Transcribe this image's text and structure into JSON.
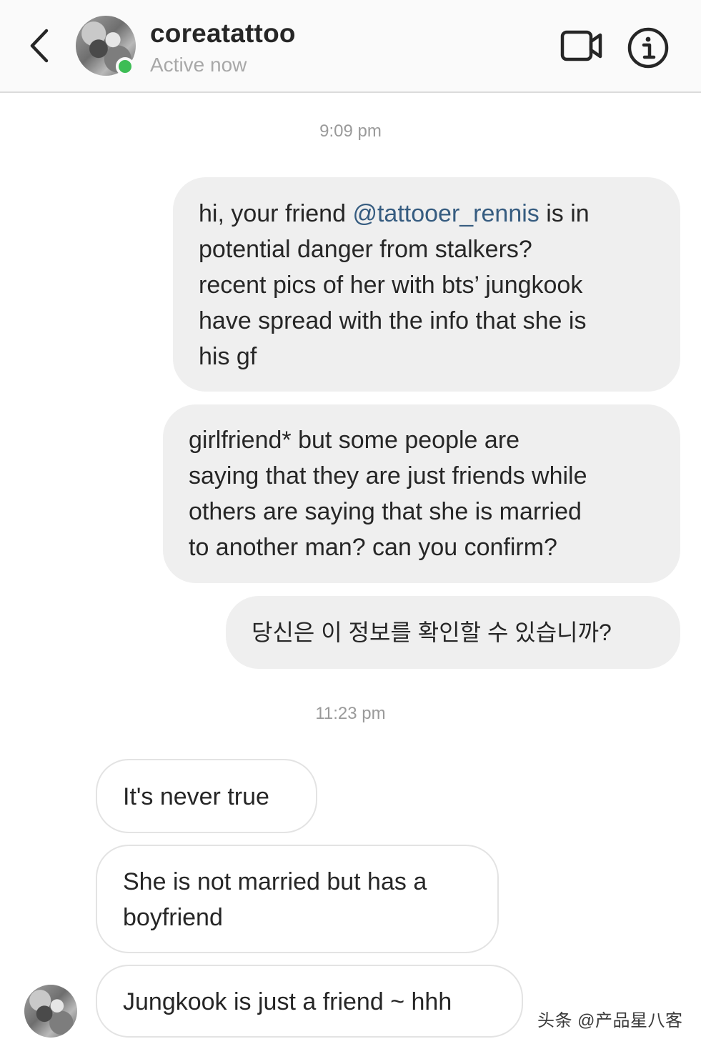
{
  "header": {
    "username": "coreatattoo",
    "status": "Active now",
    "icons": {
      "back": "chevron-left-icon",
      "video": "video-camera-icon",
      "info": "info-circle-icon"
    },
    "active_color": "#3dbd55"
  },
  "messages": {
    "timestamp_1": "9:09 pm",
    "msg1_before": "hi, your friend ",
    "msg1_mention": "@tattooer_rennis",
    "msg1_after": " is in\npotential danger from stalkers?\nrecent pics of her with bts’ jungkook\nhave spread with the info that she is\nhis gf",
    "msg2": "girlfriend* but some people are\nsaying that they are just friends while\nothers are saying that she is married\nto another man? can you confirm?",
    "msg3": "당신은 이 정보를 확인할 수 있습니까?",
    "timestamp_2": "11:23 pm",
    "msg4": "It's never true",
    "msg5": "She is not married but has a\nboyfriend",
    "msg6": "Jungkook is just a friend ~ hhh"
  },
  "watermark": "头条 @产品星八客",
  "colors": {
    "sent_bubble": "#efefef",
    "mention": "#365c80",
    "received_border": "#e3e3e3"
  }
}
